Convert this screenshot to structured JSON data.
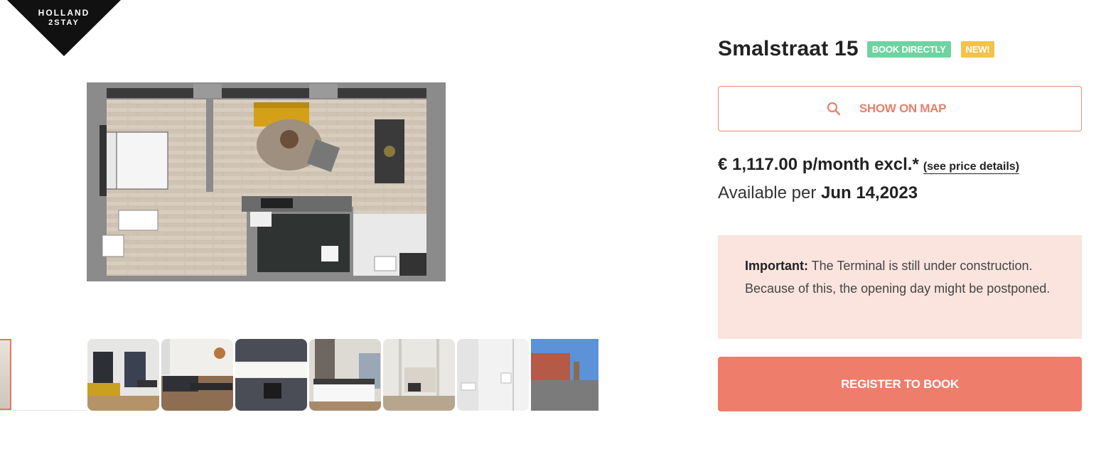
{
  "brand": {
    "line1": "HOLLAND",
    "line2": "2STAY"
  },
  "listing": {
    "title": "Smalstraat 15",
    "badges": {
      "book_directly": "BOOK DIRECTLY",
      "new": "NEW!"
    },
    "map_button": "SHOW ON MAP",
    "price": "€ 1,117.00 p/month excl.*",
    "price_details_link": "(see price details)",
    "available_label": "Available per",
    "available_date": "Jun 14,2023",
    "notice": {
      "strong": "Important:",
      "text": " The Terminal is still under construction. Because of this, the opening day might be postponed."
    },
    "register_button": "REGISTER TO BOOK"
  },
  "gallery": {
    "thumbnails": [
      "living-room",
      "dining-kitchen",
      "kitchen",
      "bedroom",
      "hallway-living",
      "bathroom",
      "exterior"
    ]
  },
  "colors": {
    "accent": "#ef7d6b",
    "accent_outline": "#ea8b78",
    "badge_book": "#6fd3a1",
    "badge_new": "#f3c24a",
    "notice_bg": "#fbe4de"
  },
  "icons": {
    "map_button": "search-icon"
  }
}
